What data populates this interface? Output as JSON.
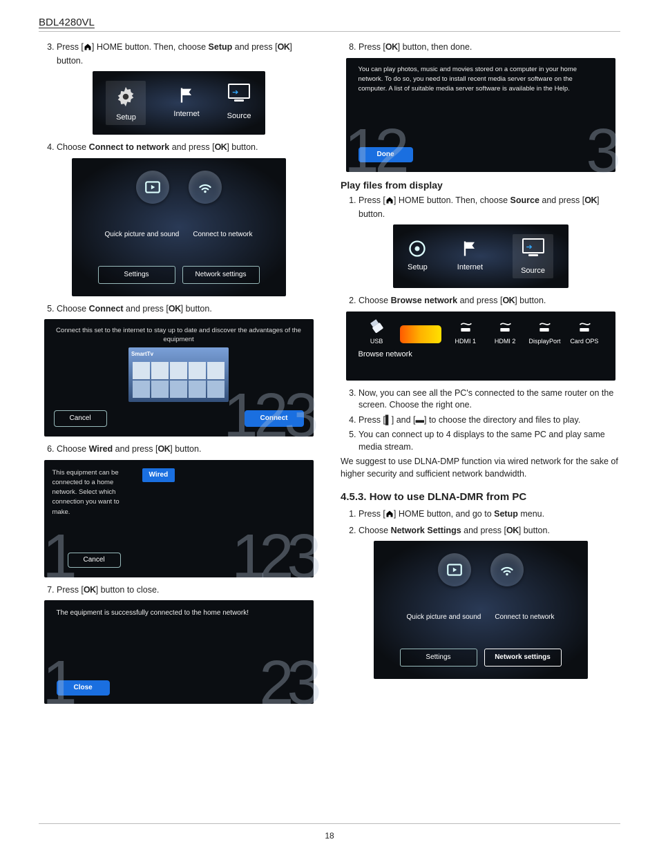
{
  "header": {
    "model": "BDL4280VL"
  },
  "page_number": "18",
  "glyph": {
    "ok": "OK"
  },
  "left": {
    "step3": {
      "pre": "Press [",
      "mid": "] HOME button. Then, choose ",
      "target": "Setup",
      "post": " and press [",
      "end": "] button."
    },
    "fig_setup": {
      "setup": "Setup",
      "internet": "Internet",
      "source": "Source"
    },
    "step4": {
      "pre": "Choose ",
      "target": "Connect to network",
      "post": " and press [",
      "end": "] button."
    },
    "fig_ctn": {
      "qps": "Quick picture and sound",
      "ctn": "Connect to network",
      "settings": "Settings",
      "netset": "Network settings"
    },
    "step5": {
      "pre": "Choose ",
      "target": "Connect",
      "post": " and press [",
      "end": "] button."
    },
    "fig_connect": {
      "top": "Connect this set to the internet to stay up to date and discover the advantages of the equipment",
      "cancel": "Cancel",
      "connect": "Connect",
      "bignum": "123"
    },
    "step6": {
      "pre": "Choose ",
      "target": "Wired",
      "post": " and press [",
      "end": "] button."
    },
    "fig_wired": {
      "side": "This equipment can be connected to a home network. Select which connection you want to make.",
      "opt": "Wired",
      "cancel": "Cancel",
      "bignum": "123"
    },
    "step7": {
      "pre": "Press [",
      "end": "] button to close."
    },
    "fig_close": {
      "msg": "The equipment is successfully connected to the home network!",
      "close": "Close",
      "bignum": "123"
    }
  },
  "right": {
    "step8": {
      "pre": "Press [",
      "end": "] button, then done."
    },
    "fig_done": {
      "msg": "You can play photos, music and movies stored on a computer in your home network. To do so, you need to install recent media server software on the computer. A list of suitable media server software is available in the Help.",
      "done": "Done",
      "big_left": "12",
      "big_right": "3"
    },
    "pfd_head": "Play files from display",
    "pfd1": {
      "pre": "Press [",
      "mid": "] HOME button. Then, choose ",
      "target": "Source",
      "post": " and press [",
      "end": "] button."
    },
    "fig_setup2": {
      "setup": "Setup",
      "internet": "Internet",
      "source": "Source"
    },
    "pfd2": {
      "pre": "Choose ",
      "target": "Browse network",
      "post": " and press [",
      "end": "] button."
    },
    "fig_sources": {
      "usb": "USB",
      "browse": "Browse network",
      "hdmi1": "HDMI 1",
      "hdmi2": "HDMI 2",
      "dp": "DisplayPort",
      "card": "Card OPS"
    },
    "pfd3": "Now, you can see all the PC's connected to the same router on the screen. Choose the right one.",
    "pfd4": {
      "pre": "Press [",
      "k1": "▌",
      "mid": "] and [",
      "k2": "▬",
      "end": "] to choose the directory and files to play."
    },
    "pfd5": "You can connect up to 4 displays to the same PC and play same media stream.",
    "pfd_note": "We suggest to use DLNA-DMP function via wired network for the sake of higher security and sufficient network bandwidth.",
    "sect453": "4.5.3.  How to use DLNA-DMR from PC",
    "dmr1": {
      "pre": "Press [",
      "mid": "] HOME button, and go to ",
      "target": "Setup",
      "end": " menu."
    },
    "dmr2": {
      "pre": "Choose ",
      "target": "Network Settings",
      "post": " and press [",
      "end": "] button."
    },
    "fig_ns": {
      "qps": "Quick picture and sound",
      "ctn": "Connect to network",
      "settings": "Settings",
      "netset": "Network settings"
    }
  }
}
